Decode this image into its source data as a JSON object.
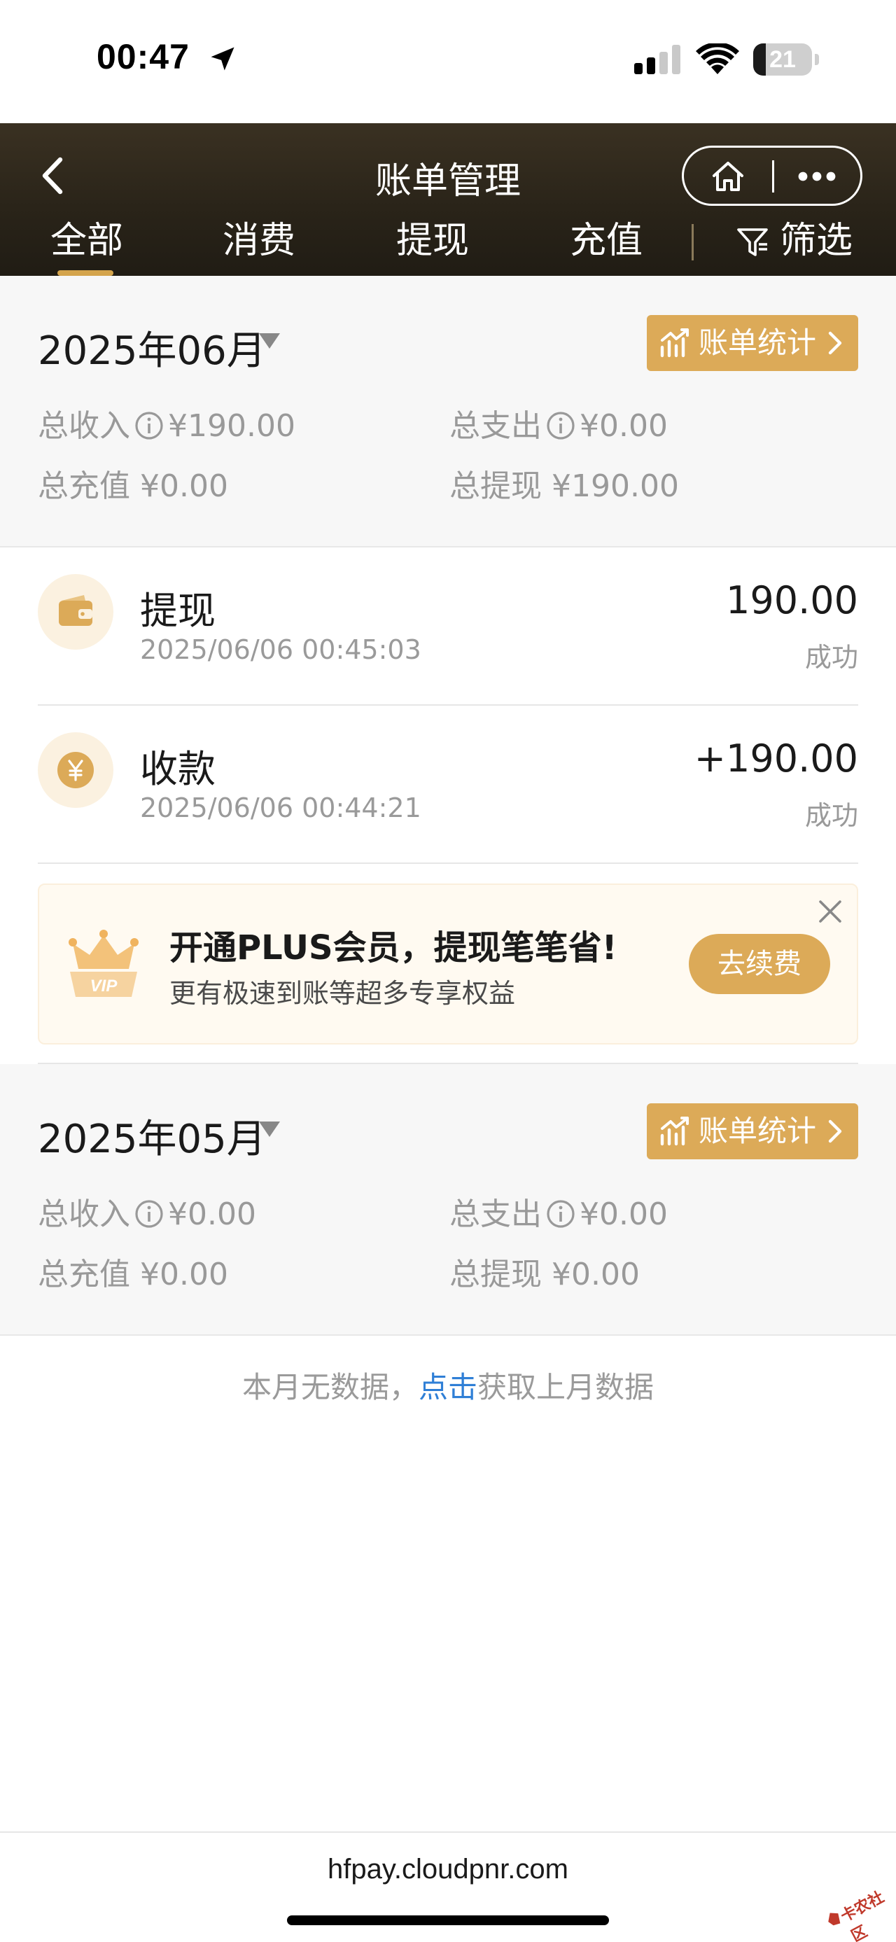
{
  "status_bar": {
    "time": "00:47",
    "battery": "21",
    "battery_level_percent": 21
  },
  "header": {
    "title": "账单管理",
    "tabs": [
      {
        "label": "全部",
        "active": true
      },
      {
        "label": "消费",
        "active": false
      },
      {
        "label": "提现",
        "active": false
      },
      {
        "label": "充值",
        "active": false
      }
    ],
    "filter_label": "筛选"
  },
  "months": [
    {
      "title": "2025年06月",
      "stats_button": "账单统计",
      "income_label": "总收入",
      "income_value": "¥190.00",
      "expense_label": "总支出",
      "expense_value": "¥0.00",
      "recharge_label": "总充值",
      "recharge_value": "¥0.00",
      "withdraw_label": "总提现",
      "withdraw_value": "¥190.00"
    },
    {
      "title": "2025年05月",
      "stats_button": "账单统计",
      "income_label": "总收入",
      "income_value": "¥0.00",
      "expense_label": "总支出",
      "expense_value": "¥0.00",
      "recharge_label": "总充值",
      "recharge_value": "¥0.00",
      "withdraw_label": "总提现",
      "withdraw_value": "¥0.00"
    }
  ],
  "transactions": [
    {
      "title": "提现",
      "time": "2025/06/06 00:45:03",
      "amount": "190.00",
      "status": "成功",
      "icon": "wallet-icon"
    },
    {
      "title": "收款",
      "time": "2025/06/06 00:44:21",
      "amount": "+190.00",
      "status": "成功",
      "icon": "yuan-coin-icon"
    }
  ],
  "banner": {
    "title": "开通PLUS会员，提现笔笔省!",
    "subtitle": "更有极速到账等超多专享权益",
    "button": "去续费",
    "badge": "VIP"
  },
  "empty_hint": {
    "prefix": "本月无数据，",
    "link": "点击",
    "suffix": "获取上月数据"
  },
  "url": "hfpay.cloudpnr.com",
  "watermark": "卡农社区",
  "colors": {
    "accent": "#dcaa58",
    "header_bg": "#2a2419",
    "link": "#2f7fd6",
    "muted": "#999999"
  }
}
